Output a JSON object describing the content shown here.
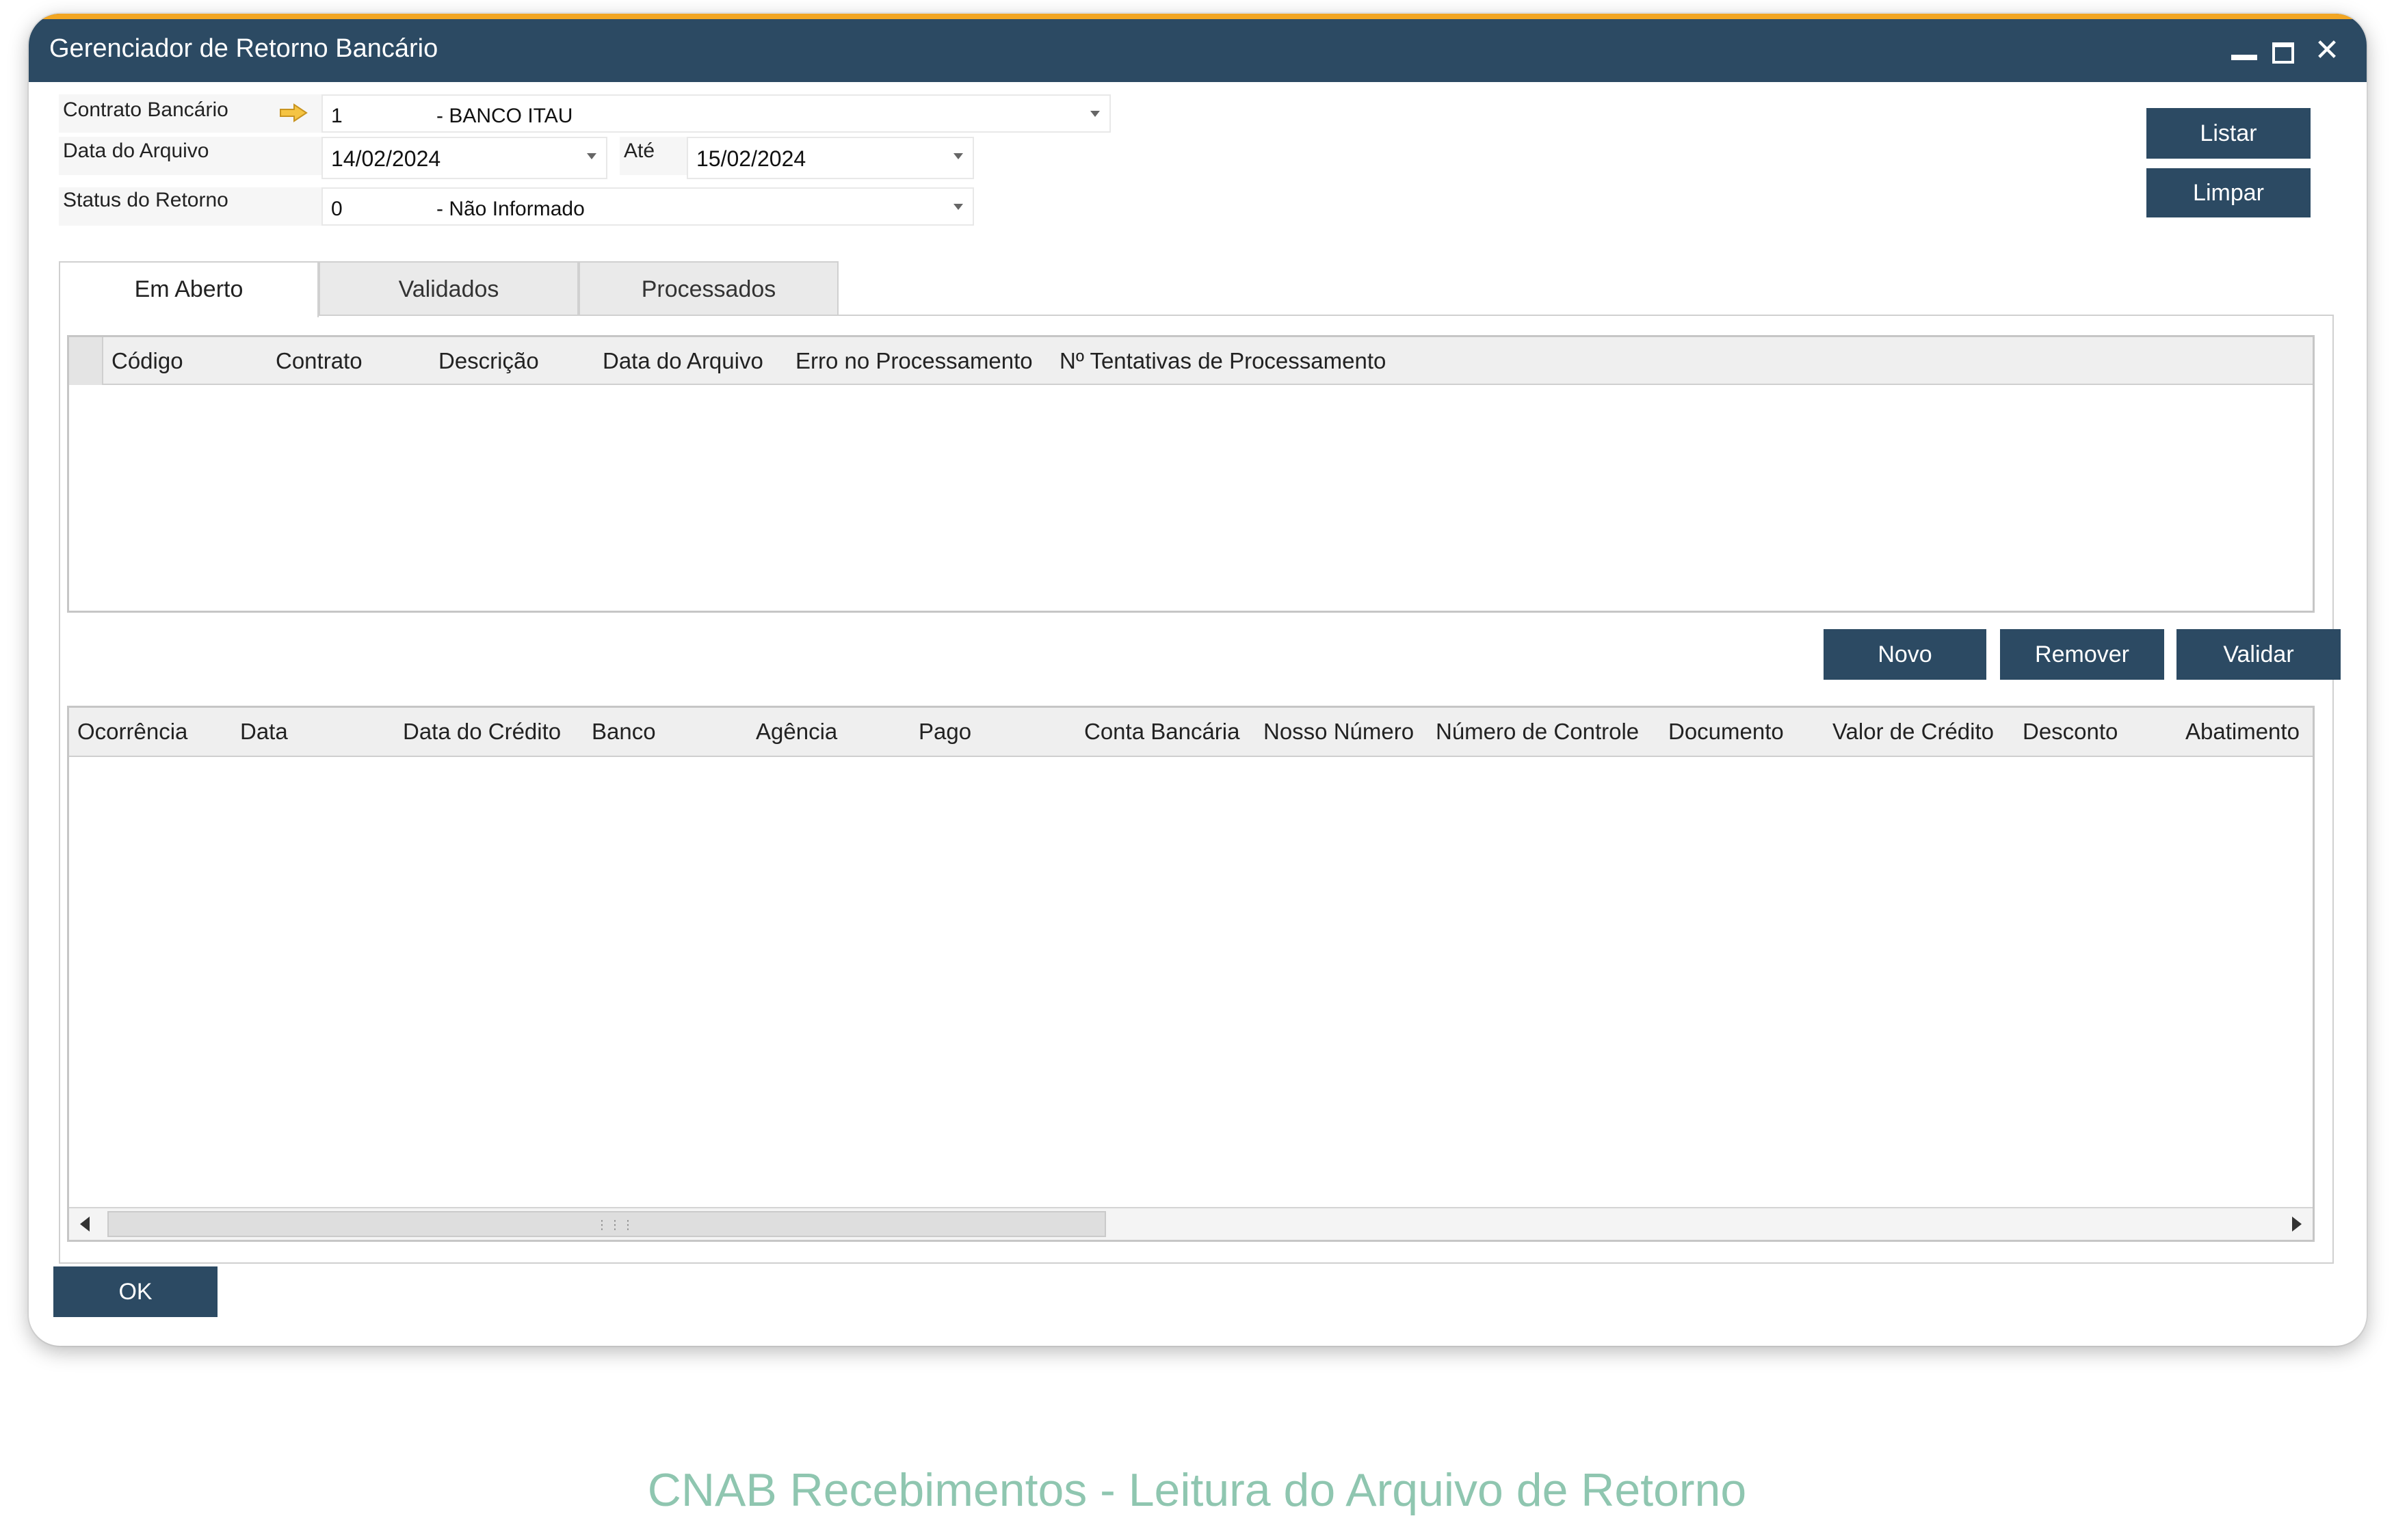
{
  "window": {
    "title": "Gerenciador de Retorno Bancário",
    "controls": {
      "close": "✕"
    }
  },
  "form": {
    "contrato_label": "Contrato Bancário",
    "contrato_code": "1",
    "contrato_desc": "- BANCO ITAU",
    "data_label": "Data do Arquivo",
    "data_from": "14/02/2024",
    "ate_label": "Até",
    "data_to": "15/02/2024",
    "status_label": "Status do Retorno",
    "status_code": "0",
    "status_desc": "- Não Informado"
  },
  "buttons": {
    "listar": "Listar",
    "limpar": "Limpar",
    "novo": "Novo",
    "remover": "Remover",
    "validar": "Validar",
    "ok": "OK"
  },
  "tabs": [
    {
      "label": "Em Aberto",
      "active": true
    },
    {
      "label": "Validados",
      "active": false
    },
    {
      "label": "Processados",
      "active": false
    }
  ],
  "grid_top": {
    "columns": [
      "Código",
      "Contrato",
      "Descrição",
      "Data do Arquivo",
      "Erro no Processamento",
      "Nº Tentativas de Processamento"
    ],
    "rows": []
  },
  "grid_bottom": {
    "columns": [
      "Ocorrência",
      "Data",
      "Data do Crédito",
      "Banco",
      "Agência",
      "Pago",
      "Conta Bancária",
      "Nosso Número",
      "Número de Controle",
      "Documento",
      "Valor de Crédito",
      "Desconto",
      "Abatimento"
    ],
    "rows": []
  },
  "caption": "CNAB Recebimentos - Leitura do Arquivo de Retorno",
  "colors": {
    "titlebar": "#2c4a63",
    "accent_top": "#f2a623",
    "button": "#2c4a63",
    "caption": "#8fc6b0"
  }
}
